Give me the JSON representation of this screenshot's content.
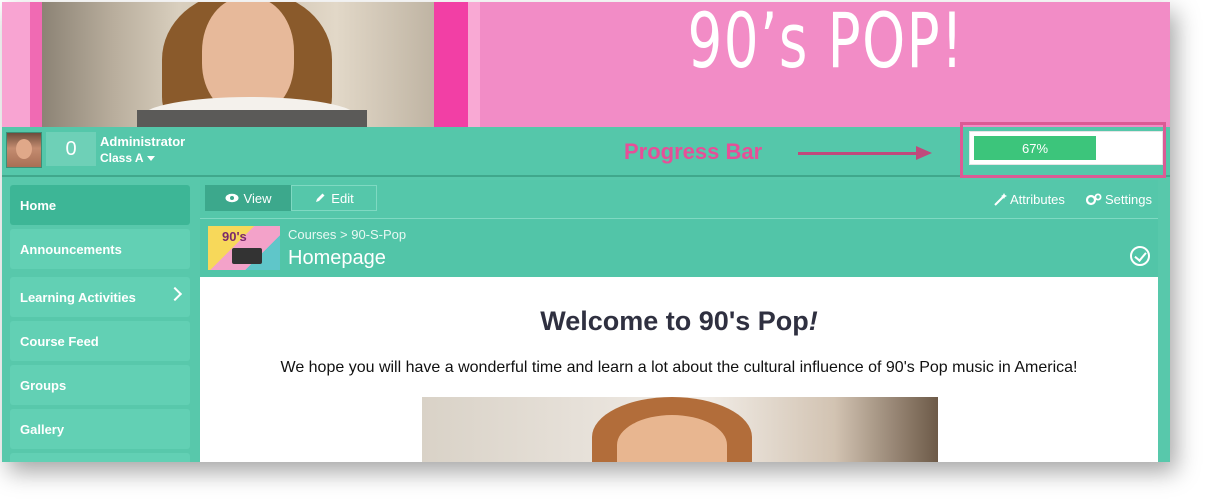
{
  "banner": {
    "title": "90’s POP!"
  },
  "header": {
    "points": "0",
    "user_name": "Administrator",
    "class_selector": "Class A",
    "annotation_label": "Progress Bar",
    "progress": {
      "value": 0.67,
      "label": "67%"
    }
  },
  "sidebar": {
    "items": [
      {
        "label": "Home",
        "active": true
      },
      {
        "label": "Announcements"
      },
      {
        "label": "Learning Activities",
        "has_submenu": true
      },
      {
        "label": "Course Feed"
      },
      {
        "label": "Groups"
      },
      {
        "label": "Gallery"
      }
    ]
  },
  "toolbar": {
    "view_label": "View",
    "edit_label": "Edit",
    "attributes_label": "Attributes",
    "settings_label": "Settings"
  },
  "page": {
    "thumbnail_text": "90's",
    "breadcrumb": "Courses > 90-S-Pop",
    "title": "Homepage",
    "welcome_main": "Welcome to 90's Pop",
    "welcome_mark": "!",
    "intro": "We hope you will have a wonderful time and learn a lot about the cultural influence of 90's Pop music in America!"
  },
  "colors": {
    "teal": "#55c7aa",
    "active_teal": "#3db696",
    "pink_banner": "#f28cc6",
    "progress_green": "#3cc57b",
    "annotation_pink": "#e64f98"
  },
  "icons": [
    "eye-icon",
    "pencil-icon",
    "magic-wand-icon",
    "gears-icon",
    "check-circle-icon",
    "chevron-right-icon",
    "caret-down-icon"
  ]
}
